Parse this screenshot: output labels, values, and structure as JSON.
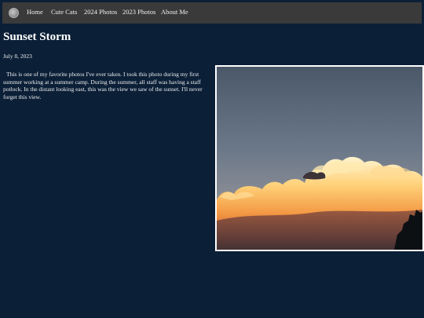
{
  "nav": {
    "logo_icon": "circle-logo-icon",
    "items": [
      {
        "label": "Home"
      },
      {
        "label": "Cute Cats"
      },
      {
        "label": "2024 Photos"
      },
      {
        "label": "2023 Photos"
      },
      {
        "label": "About Me"
      }
    ]
  },
  "post": {
    "title": "Sunset Storm",
    "date": "July 8, 2023",
    "body": "This is one of my favorite photos I've ever taken. I took this photo during my first summer working at a summer camp. During the summer, all staff was having a staff potlock. In the distant looking east, this was the view we saw of the sunset. I'll never forget this view."
  },
  "colors": {
    "page_background": "#0b1f37",
    "navbar_background": "#3a3a3a",
    "frame_border": "#ffffff"
  }
}
